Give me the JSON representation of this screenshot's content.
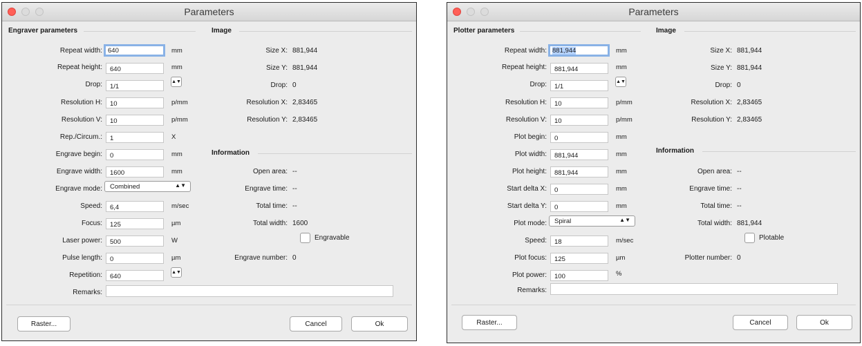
{
  "left": {
    "title": "Parameters",
    "section_params": "Engraver parameters",
    "section_image": "Image",
    "section_info": "Information",
    "rows": [
      {
        "label": "Repeat width:",
        "value": "640",
        "unit": "mm"
      },
      {
        "label": "Repeat height:",
        "value": "640",
        "unit": "mm"
      },
      {
        "label": "Drop:",
        "value": "1/1",
        "stepper": "up-down-icon"
      },
      {
        "label": "Resolution H:",
        "value": "10",
        "unit": "p/mm"
      },
      {
        "label": "Resolution V:",
        "value": "10",
        "unit": "p/mm"
      },
      {
        "label": "Rep./Circum.:",
        "value": "1",
        "unit": "X"
      },
      {
        "label": "Engrave begin:",
        "value": "0",
        "unit": "mm"
      },
      {
        "label": "Engrave width:",
        "value": "1600",
        "unit": "mm"
      },
      {
        "label": "Engrave mode:",
        "select": "Combined"
      },
      {
        "label": "Speed:",
        "value": "6,4",
        "unit": "m/sec"
      },
      {
        "label": "Focus:",
        "value": "125",
        "unit": "µm"
      },
      {
        "label": "Laser power:",
        "value": "500",
        "unit": "W"
      },
      {
        "label": "Pulse length:",
        "value": "0",
        "unit": "µm"
      },
      {
        "label": "Repetition:",
        "value": "640",
        "stepper": "up-down-icon"
      }
    ],
    "image": [
      {
        "label": "Size X:",
        "value": "881,944"
      },
      {
        "label": "Size Y:",
        "value": "881,944"
      },
      {
        "label": "Drop:",
        "value": "0"
      },
      {
        "label": "Resolution X:",
        "value": "2,83465"
      },
      {
        "label": "Resolution Y:",
        "value": "2,83465"
      }
    ],
    "info": [
      {
        "label": "Open area:",
        "value": "--"
      },
      {
        "label": "Engrave time:",
        "value": "--"
      },
      {
        "label": "Total time:",
        "value": "--"
      },
      {
        "label": "Total width:",
        "value": "1600"
      }
    ],
    "checkbox_label": "Engravable",
    "number": {
      "label": "Engrave number:",
      "value": "0"
    },
    "remarks_label": "Remarks:",
    "buttons": {
      "raster": "Raster...",
      "cancel": "Cancel",
      "ok": "Ok"
    }
  },
  "right": {
    "title": "Parameters",
    "section_params": "Plotter parameters",
    "section_image": "Image",
    "section_info": "Information",
    "rows": [
      {
        "label": "Repeat width:",
        "value": "881,944",
        "unit": "mm"
      },
      {
        "label": "Repeat height:",
        "value": "881,944",
        "unit": "mm"
      },
      {
        "label": "Drop:",
        "value": "1/1",
        "stepper": "up-down-icon"
      },
      {
        "label": "Resolution H:",
        "value": "10",
        "unit": "p/mm"
      },
      {
        "label": "Resolution V:",
        "value": "10",
        "unit": "p/mm"
      },
      {
        "label": "Plot begin:",
        "value": "0",
        "unit": "mm"
      },
      {
        "label": "Plot width:",
        "value": "881,944",
        "unit": "mm"
      },
      {
        "label": "Plot height:",
        "value": "881,944",
        "unit": "mm"
      },
      {
        "label": "Start delta X:",
        "value": "0",
        "unit": "mm"
      },
      {
        "label": "Start delta Y:",
        "value": "0",
        "unit": "mm"
      },
      {
        "label": "Plot mode:",
        "select": "Spiral"
      },
      {
        "label": "Speed:",
        "value": "18",
        "unit": "m/sec"
      },
      {
        "label": "Plot focus:",
        "value": "125",
        "unit": "µm"
      },
      {
        "label": "Plot power:",
        "value": "100",
        "unit": "%"
      }
    ],
    "image": [
      {
        "label": "Size X:",
        "value": "881,944"
      },
      {
        "label": "Size Y:",
        "value": "881,944"
      },
      {
        "label": "Drop:",
        "value": "0"
      },
      {
        "label": "Resolution X:",
        "value": "2,83465"
      },
      {
        "label": "Resolution Y:",
        "value": "2,83465"
      }
    ],
    "info": [
      {
        "label": "Open area:",
        "value": "--"
      },
      {
        "label": "Engrave time:",
        "value": "--"
      },
      {
        "label": "Total time:",
        "value": "--"
      },
      {
        "label": "Total width:",
        "value": "881,944"
      }
    ],
    "checkbox_label": "Plotable",
    "number": {
      "label": "Plotter number:",
      "value": "0"
    },
    "remarks_label": "Remarks:",
    "buttons": {
      "raster": "Raster...",
      "cancel": "Cancel",
      "ok": "Ok"
    }
  }
}
